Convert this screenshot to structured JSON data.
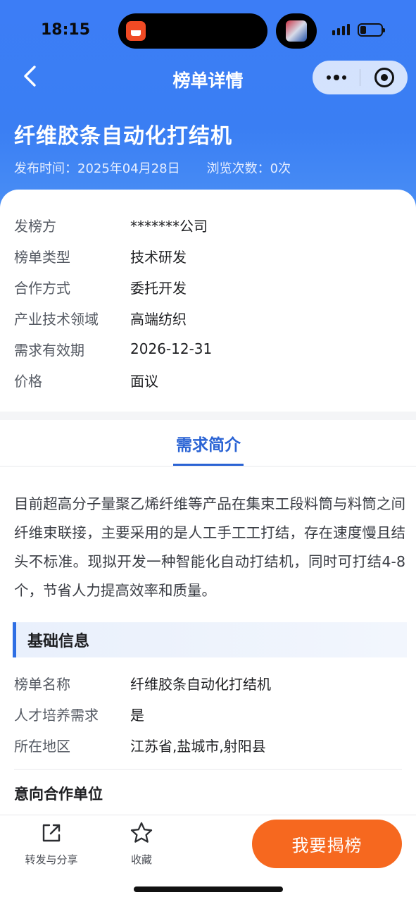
{
  "status_bar": {
    "time": "18:15"
  },
  "nav": {
    "title": "榜单详情"
  },
  "hero": {
    "title": "纤维胶条自动化打结机",
    "publish_label": "发布时间：",
    "publish_date": "2025年04月28日",
    "views_label": "浏览次数：",
    "views_count": "0次"
  },
  "details": [
    {
      "key": "发榜方",
      "value": "*******公司"
    },
    {
      "key": "榜单类型",
      "value": "技术研发"
    },
    {
      "key": "合作方式",
      "value": "委托开发"
    },
    {
      "key": "产业技术领域",
      "value": "高端纺织"
    },
    {
      "key": "需求有效期",
      "value": "2026-12-31"
    },
    {
      "key": "价格",
      "value": "面议"
    }
  ],
  "tab": {
    "label": "需求简介"
  },
  "intro": "目前超高分子量聚乙烯纤维等产品在集束工段料筒与料筒之间纤维束联接，主要采用的是人工手工工打结，存在速度慢且结头不标准。现拟开发一种智能化自动打结机，同时可打结4-8个，节省人力提高效率和质量。",
  "basic_info": {
    "heading": "基础信息",
    "rows": [
      {
        "key": "榜单名称",
        "value": "纤维胶条自动化打结机"
      },
      {
        "key": "人才培养需求",
        "value": "是"
      },
      {
        "key": "所在地区",
        "value": "江苏省,盐城市,射阳县"
      }
    ]
  },
  "partner": {
    "heading": "意向合作单位"
  },
  "bottom": {
    "share_label": "转发与分享",
    "favorite_label": "收藏",
    "cta_label": "我要揭榜"
  },
  "colors": {
    "hero_blue": "#3c7df6",
    "accent_blue": "#2a63d4",
    "cta_orange": "#f6681f"
  }
}
